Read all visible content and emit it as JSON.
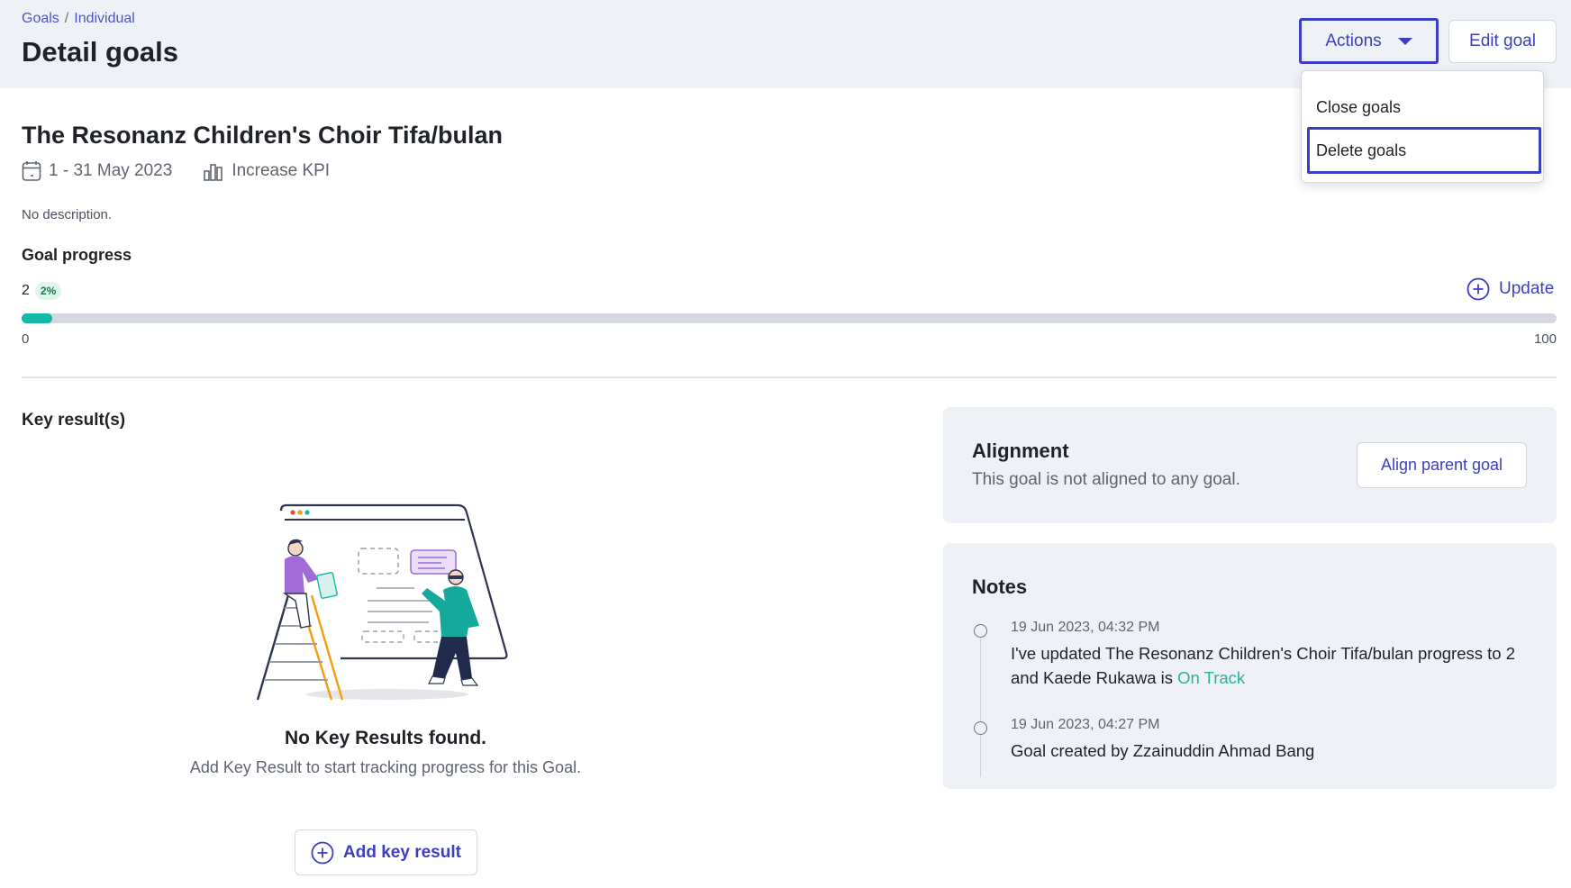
{
  "breadcrumb": {
    "root": "Goals",
    "separator": "/",
    "current": "Individual"
  },
  "header": {
    "title": "Detail goals",
    "actions_label": "Actions",
    "edit_label": "Edit goal"
  },
  "actions_menu": {
    "items": [
      {
        "label": "Close goals"
      },
      {
        "label": "Delete goals"
      }
    ]
  },
  "goal": {
    "title": "The Resonanz Children's Choir Tifa/bulan",
    "date_range": "1 - 31 May 2023",
    "type": "Increase KPI",
    "description": "No description."
  },
  "progress": {
    "label": "Goal progress",
    "value": "2",
    "percent_label": "2%",
    "fraction": 0.02,
    "min_label": "0",
    "max_label": "100",
    "update_label": "Update",
    "fill_color": "#14b8a6"
  },
  "key_results": {
    "label": "Key result(s)",
    "empty_title": "No Key Results found.",
    "empty_subtitle": "Add Key Result to start tracking progress for this Goal.",
    "add_label": "Add key result"
  },
  "alignment": {
    "title": "Alignment",
    "subtitle": "This goal is not aligned to any goal.",
    "button_label": "Align parent goal"
  },
  "notes": {
    "title": "Notes",
    "items": [
      {
        "time": "19 Jun 2023, 04:32 PM",
        "text": "I've updated The Resonanz Children's Choir Tifa/bulan progress to 2 and Kaede Rukawa is ",
        "status": "On Track"
      },
      {
        "time": "19 Jun 2023, 04:27 PM",
        "text": "Goal created by Zzainuddin Ahmad Bang"
      }
    ]
  },
  "colors": {
    "accent": "#3c3fc2",
    "header_bg": "#eef1f6",
    "on_track": "#2bb3a0"
  }
}
